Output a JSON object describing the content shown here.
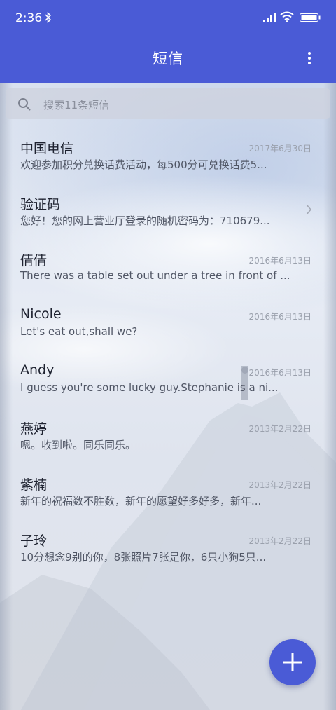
{
  "status_bar": {
    "time": "2:36"
  },
  "header": {
    "title": "短信"
  },
  "search": {
    "placeholder": "搜索11条短信"
  },
  "conversations": [
    {
      "name": "中国电信",
      "date": "2017年6月30日",
      "preview": "欢迎参加积分兑换话费活动，每500分可兑换话费5..."
    },
    {
      "name": "验证码",
      "date": "",
      "preview": "您好！您的网上营业厅登录的随机密码为：710679..."
    },
    {
      "name": "倩倩",
      "date": "2016年6月13日",
      "preview": "There was a table set out under a tree in front of ..."
    },
    {
      "name": "Nicole",
      "date": "2016年6月13日",
      "preview": "Let's eat out,shall we?"
    },
    {
      "name": "Andy",
      "date": "2016年6月13日",
      "preview": "I guess you're some lucky guy.Stephanie is a ni..."
    },
    {
      "name": "燕婷",
      "date": "2013年2月22日",
      "preview": "嗯。收到啦。同乐同乐。"
    },
    {
      "name": "紫楠",
      "date": "2013年2月22日",
      "preview": "新年的祝福数不胜数，新年的愿望好多好多，新年..."
    },
    {
      "name": "子玲",
      "date": "2013年2月22日",
      "preview": "10分想念9别的你，8张照片7张是你，6只小狗5只..."
    }
  ],
  "icons": {
    "bluetooth": "bluetooth-icon",
    "signal": "signal-icon",
    "wifi": "wifi-icon",
    "battery": "battery-icon",
    "more": "more-vertical-icon",
    "search": "search-icon",
    "chevron": "chevron-right-icon",
    "compose": "plus-icon"
  },
  "colors": {
    "accent": "#4a5bd6",
    "header_text": "#ffffff"
  }
}
